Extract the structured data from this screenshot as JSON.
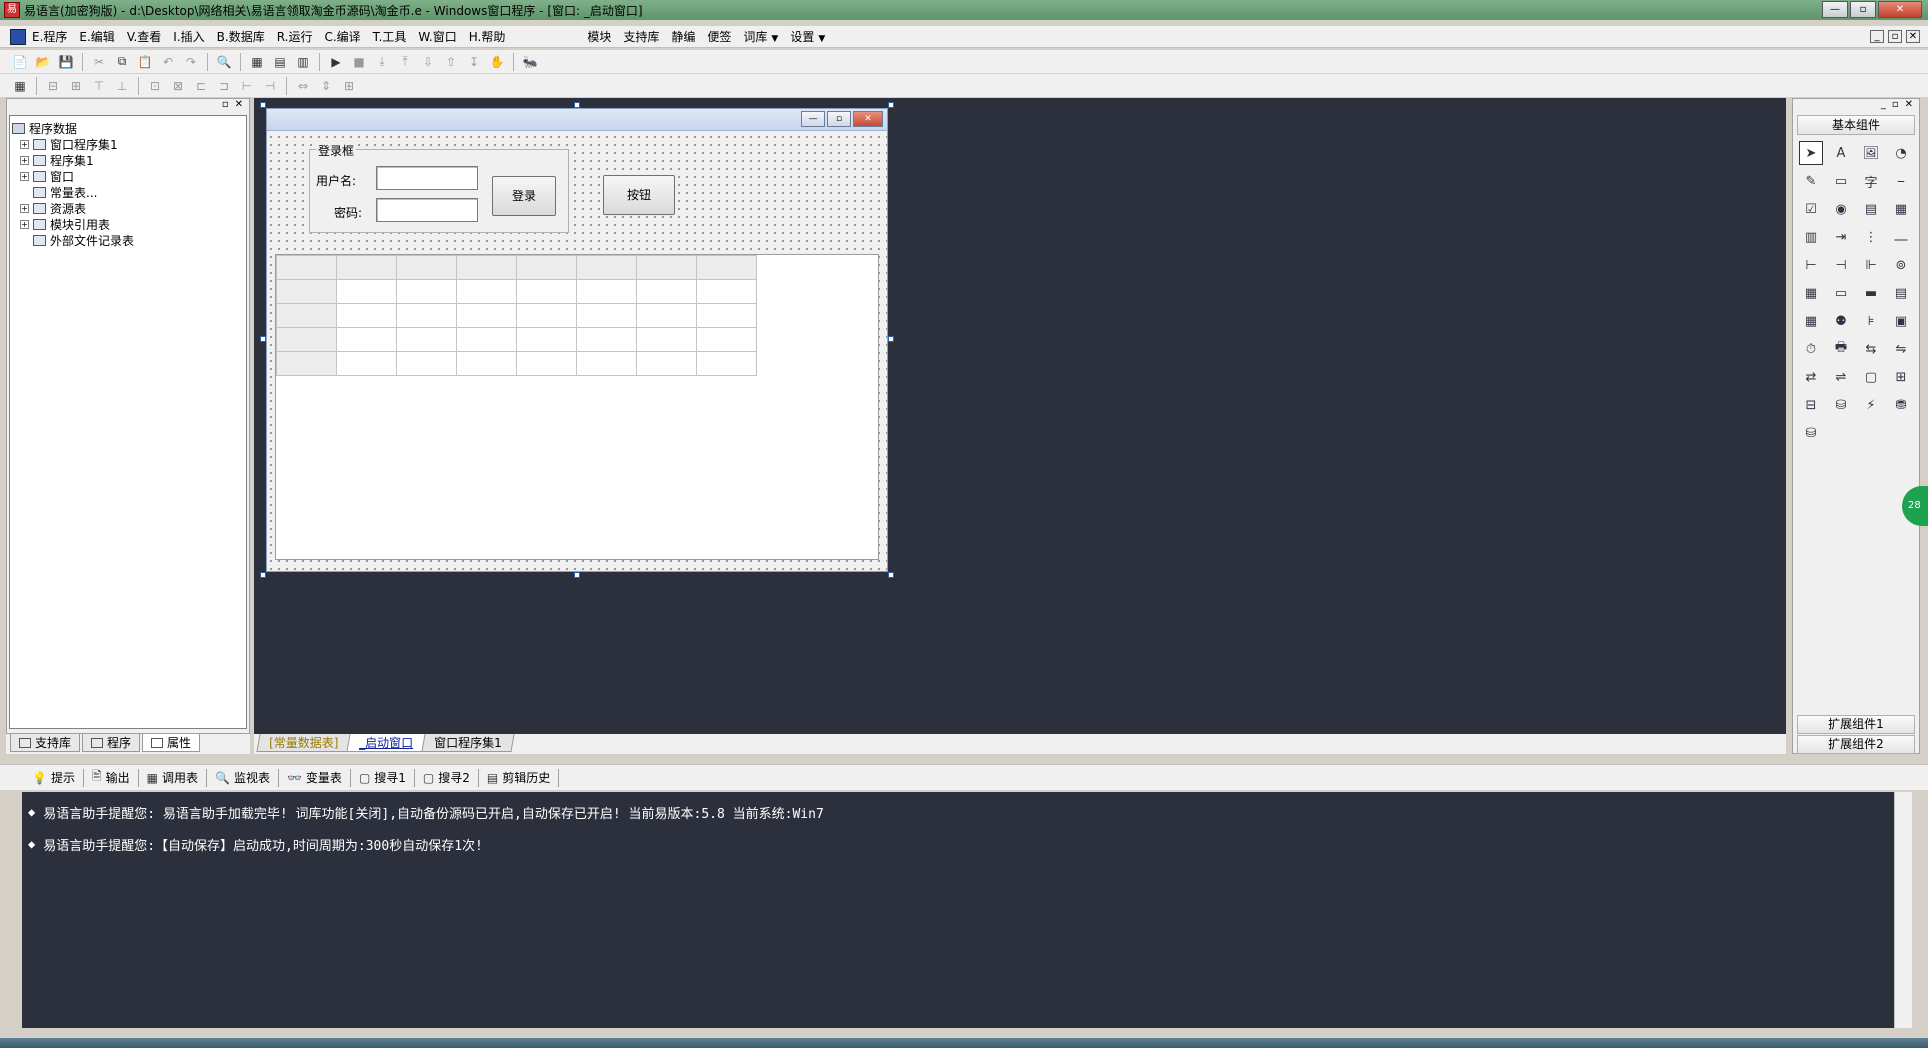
{
  "window": {
    "title": "易语言(加密狗版) - d:\\Desktop\\网络相关\\易语言领取淘金币源码\\淘金币.e - Windows窗口程序 - [窗口: _启动窗口]",
    "minimize": "—",
    "maximize": "▫",
    "close": "✕"
  },
  "menubar": {
    "items": [
      "E.程序",
      "E.编辑",
      "V.查看",
      "I.插入",
      "B.数据库",
      "R.运行",
      "C.编译",
      "T.工具",
      "W.窗口",
      "H.帮助"
    ],
    "extras": [
      "模块",
      "支持库",
      "静编",
      "便签",
      "词库",
      "设置"
    ],
    "dropdown_arrow": "▼",
    "mdi_controls": [
      "_",
      "▫",
      "✕"
    ]
  },
  "toolbar1": [
    "📄",
    "📂",
    "💾",
    "✂",
    "⧉",
    "📋",
    "↶",
    "↷",
    "🔍",
    "▦",
    "▤",
    "▥",
    "▶",
    "■",
    "⤓",
    "⤒",
    "⇩",
    "⇧",
    "↧",
    "✋",
    "🐜"
  ],
  "toolbar2": [
    "▦",
    "⊟",
    "⊞",
    "⊤",
    "⊥",
    "⊡",
    "⊠",
    "⊏",
    "⊐",
    "⊢",
    "⊣",
    "⇔",
    "⇕",
    "⊞"
  ],
  "left_panel": {
    "tree": [
      {
        "label": "程序数据",
        "root": true
      },
      {
        "label": "窗口程序集1",
        "expandable": true
      },
      {
        "label": "程序集1",
        "expandable": true
      },
      {
        "label": "窗口",
        "expandable": true
      },
      {
        "label": "常量表...",
        "expandable": false
      },
      {
        "label": "资源表",
        "expandable": true
      },
      {
        "label": "模块引用表",
        "expandable": true
      },
      {
        "label": "外部文件记录表",
        "expandable": false
      }
    ],
    "tabs": [
      "支持库",
      "程序",
      "属性"
    ]
  },
  "form": {
    "group_label": "登录框",
    "username_label": "用户名:",
    "password_label": "密码:",
    "login_button": "登录",
    "button": "按钮"
  },
  "design_tabs": [
    "[常量数据表]",
    "_启动窗口",
    "窗口程序集1"
  ],
  "right_panel": {
    "title": "基本组件",
    "components": [
      "➤",
      "A",
      "🖼",
      "◔",
      "✎",
      "▭",
      "字",
      "⎯",
      "☑",
      "◉",
      "▤",
      "▦",
      "▥",
      "⇥",
      "⋮",
      "⎼",
      "⊢",
      "⊣",
      "⊩",
      "⊚",
      "▦",
      "▭",
      "▬",
      "▤",
      "▦",
      "⚉",
      "⊧",
      "▣",
      "⏱",
      "🖶",
      "⇆",
      "⇋",
      "⇄",
      "⇌",
      "▢",
      "⊞",
      "⊟",
      "⛁",
      "⚡",
      "⛃",
      "⛁"
    ],
    "ext1": "扩展组件1",
    "ext2": "扩展组件2",
    "bubble": "28"
  },
  "output_tabs": [
    "提示",
    "输出",
    "调用表",
    "监视表",
    "变量表",
    "搜寻1",
    "搜寻2",
    "剪辑历史"
  ],
  "output_tab_icons": [
    "💡",
    "🖹",
    "▦",
    "🔍",
    "👓",
    "▢",
    "▢",
    "▤"
  ],
  "output_lines": [
    "易语言助手提醒您:  易语言助手加载完毕! 词库功能[关闭],自动备份源码已开启,自动保存已开启! 当前易版本:5.8  当前系统:Win7",
    "易语言助手提醒您:【自动保存】启动成功,时间周期为:300秒自动保存1次!"
  ]
}
